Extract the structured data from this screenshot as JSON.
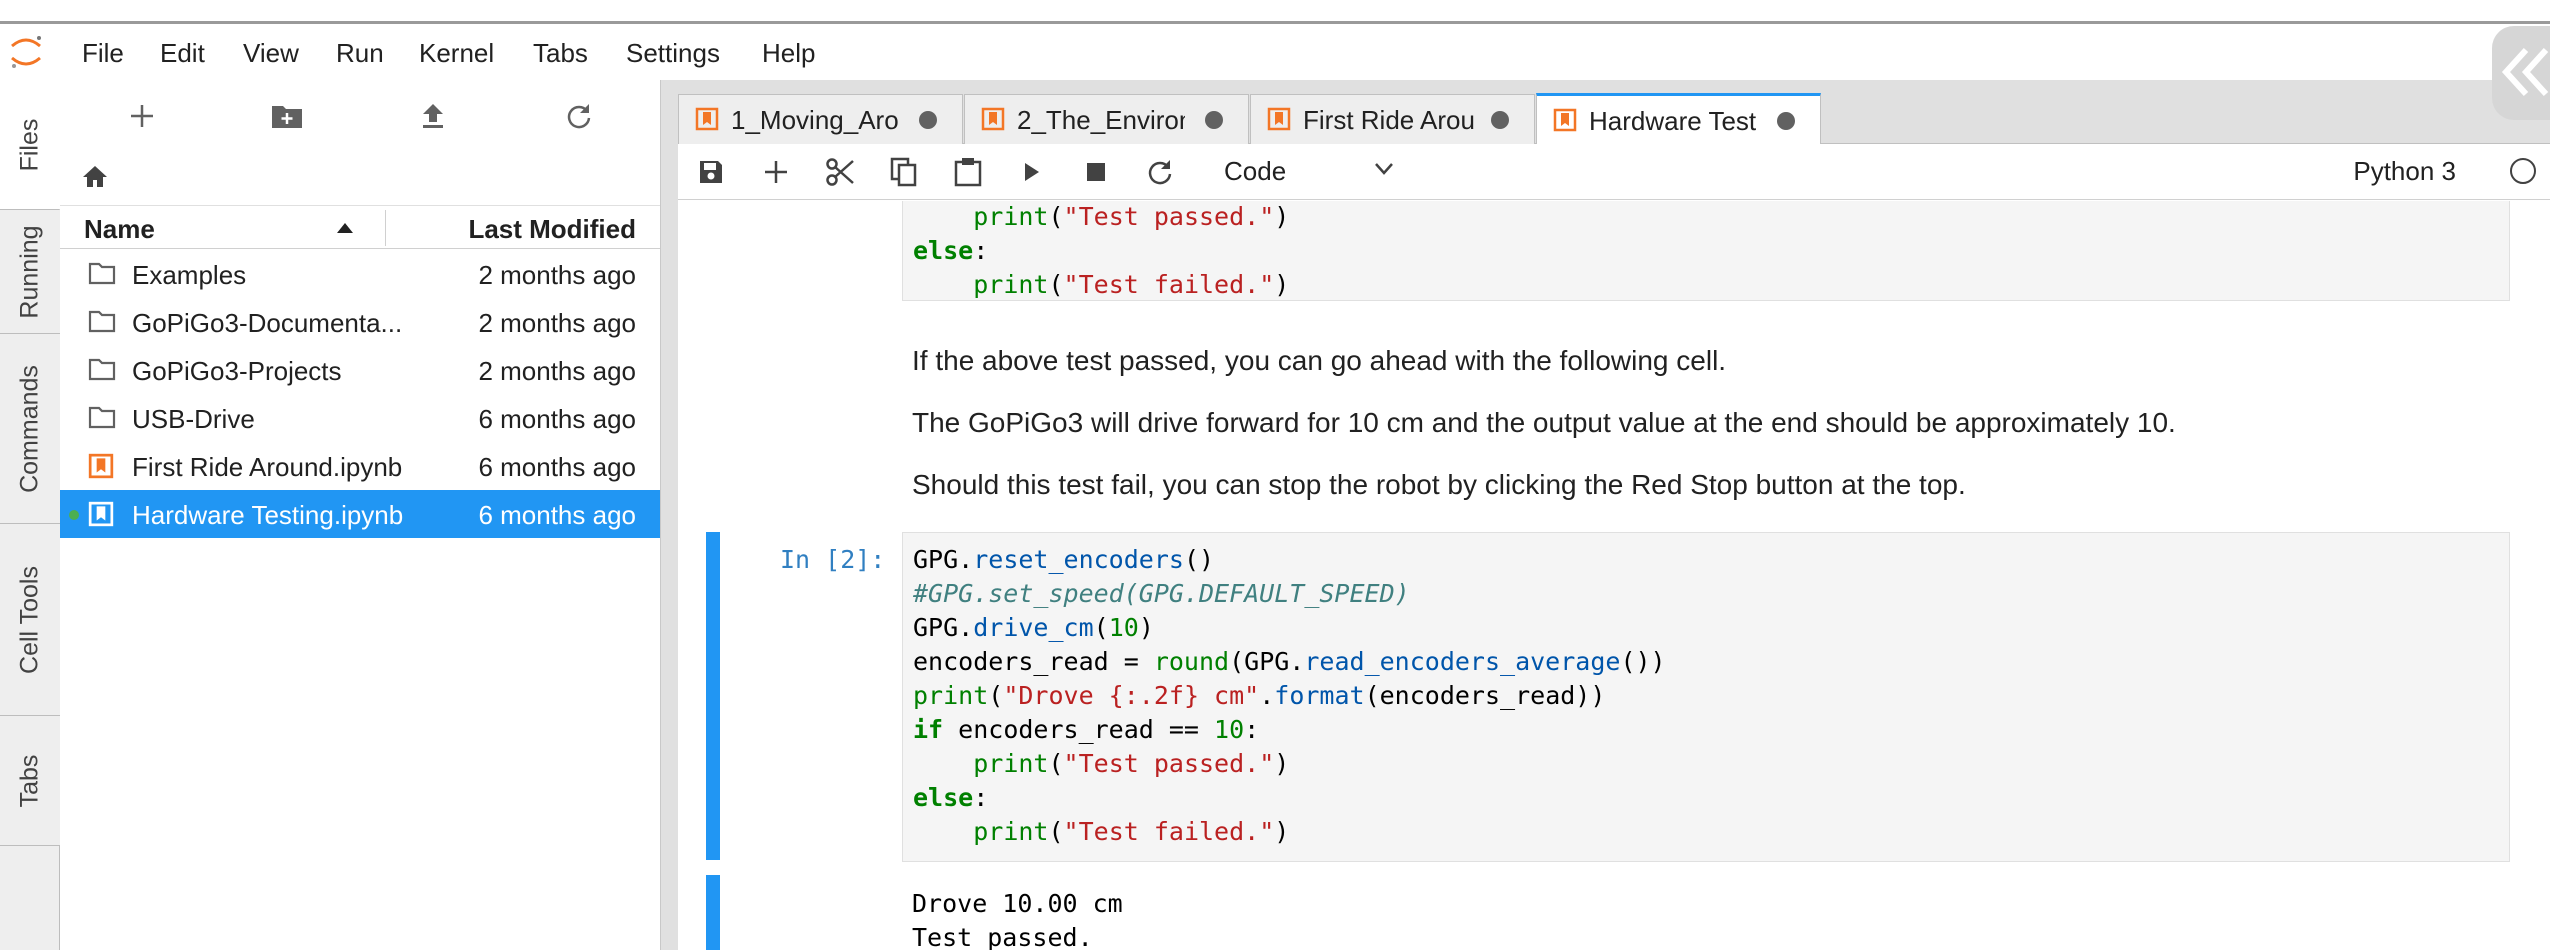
{
  "menubar": {
    "items": [
      "File",
      "Edit",
      "View",
      "Run",
      "Kernel",
      "Tabs",
      "Settings",
      "Help"
    ]
  },
  "left_tabs": [
    "Files",
    "Running",
    "Commands",
    "Cell Tools",
    "Tabs"
  ],
  "file_browser": {
    "columns": {
      "name": "Name",
      "modified": "Last Modified"
    },
    "rows": [
      {
        "name": "Examples",
        "modified": "2 months ago",
        "type": "folder"
      },
      {
        "name": "GoPiGo3-Documenta...",
        "modified": "2 months ago",
        "type": "folder"
      },
      {
        "name": "GoPiGo3-Projects",
        "modified": "2 months ago",
        "type": "folder"
      },
      {
        "name": "USB-Drive",
        "modified": "6 months ago",
        "type": "folder"
      },
      {
        "name": "First Ride Around.ipynb",
        "modified": "6 months ago",
        "type": "notebook"
      },
      {
        "name": "Hardware Testing.ipynb",
        "modified": "6 months ago",
        "type": "notebook",
        "selected": true,
        "running": true
      }
    ]
  },
  "tabs": [
    {
      "label": "1_Moving_Arou"
    },
    {
      "label": "2_The_Environi"
    },
    {
      "label": "First Ride Arou"
    },
    {
      "label": "Hardware Test",
      "active": true
    }
  ],
  "notebook_toolbar": {
    "cell_type": "Code",
    "kernel": "Python 3"
  },
  "cells": {
    "prev_code": {
      "line1_indent": "    ",
      "line1_fn": "print",
      "line1_str": "\"Test passed.\"",
      "line2_kw": "else",
      "line2_rest": ":",
      "line3_indent": "    ",
      "line3_fn": "print",
      "line3_str": "\"Test failed.\""
    },
    "markdown": [
      "If the above test passed, you can go ahead with the following cell.",
      "The GoPiGo3 will drive forward for 10 cm and the output value at the end should be approximately 10.",
      "Should this test fail, you can stop the robot by clicking the Red Stop button at the top."
    ],
    "code_cell": {
      "prompt": "In [2]:",
      "l1_obj": "GPG.",
      "l1_attr": "reset_encoders",
      "l1_rest": "()",
      "l2_comment": "#GPG.set_speed(GPG.DEFAULT_SPEED)",
      "l3_obj": "GPG.",
      "l3_attr": "drive_cm",
      "l3_open": "(",
      "l3_num": "10",
      "l3_close": ")",
      "l4_a": "encoders_read = ",
      "l4_fn": "round",
      "l4_b": "(GPG.",
      "l4_attr": "read_encoders_average",
      "l4_c": "())",
      "l5_fn": "print",
      "l5_a": "(",
      "l5_str": "\"Drove {:.2f} cm\"",
      "l5_b": ".",
      "l5_attr": "format",
      "l5_c": "(encoders_read))",
      "l6_kw": "if",
      "l6_a": " encoders_read == ",
      "l6_num": "10",
      "l6_b": ":",
      "l7_indent": "    ",
      "l7_fn": "print",
      "l7_a": "(",
      "l7_str": "\"Test passed.\"",
      "l7_b": ")",
      "l8_kw": "else",
      "l8_a": ":",
      "l9_indent": "    ",
      "l9_fn": "print",
      "l9_a": "(",
      "l9_str": "\"Test failed.\"",
      "l9_b": ")"
    },
    "output": [
      "Drove 10.00 cm",
      "Test passed."
    ]
  },
  "colors": {
    "accent": "#2196f3",
    "notebook_icon": "#f37626",
    "selected_row": "#2196f3",
    "running_dot": "#4caf50"
  },
  "icons": {
    "file_browser_toolbar": [
      "plus-icon",
      "new-folder-icon",
      "upload-icon",
      "refresh-icon"
    ],
    "notebook_toolbar": [
      "save-icon",
      "plus-icon",
      "cut-icon",
      "copy-icon",
      "paste-icon",
      "run-icon",
      "stop-icon",
      "restart-icon"
    ]
  }
}
